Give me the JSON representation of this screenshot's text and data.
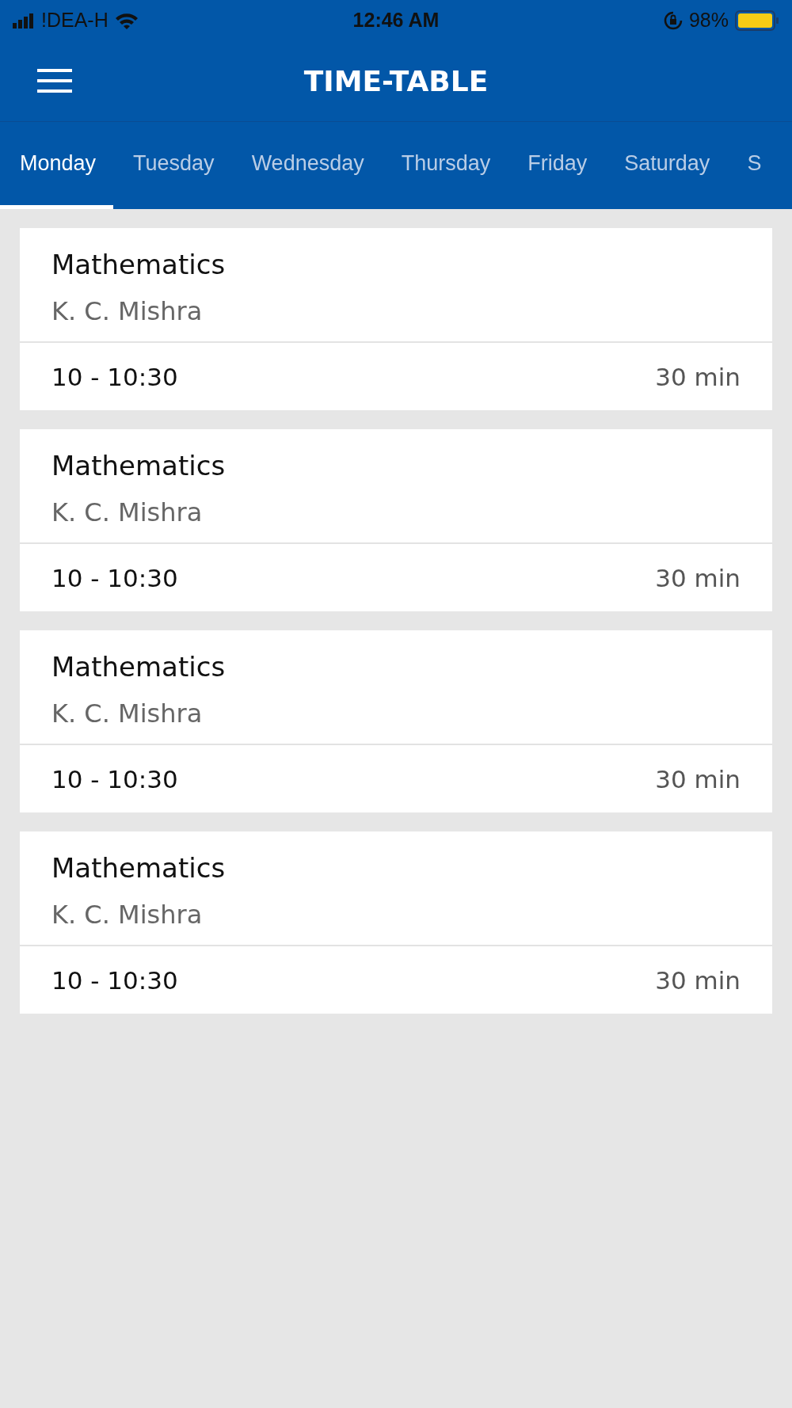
{
  "status_bar": {
    "carrier": "!DEA-H",
    "time": "12:46 AM",
    "battery": "98%"
  },
  "header": {
    "title": "TIME-TABLE"
  },
  "tabs": [
    {
      "label": "Monday",
      "selected": true
    },
    {
      "label": "Tuesday",
      "selected": false
    },
    {
      "label": "Wednesday",
      "selected": false
    },
    {
      "label": "Thursday",
      "selected": false
    },
    {
      "label": "Friday",
      "selected": false
    },
    {
      "label": "Saturday",
      "selected": false
    },
    {
      "label": "S",
      "selected": false
    }
  ],
  "classes": [
    {
      "subject": "Mathematics",
      "teacher": "K. C. Mishra",
      "time": "10 - 10:30",
      "duration": "30 min"
    },
    {
      "subject": "Mathematics",
      "teacher": "K. C. Mishra",
      "time": "10 - 10:30",
      "duration": "30 min"
    },
    {
      "subject": "Mathematics",
      "teacher": "K. C. Mishra",
      "time": "10 - 10:30",
      "duration": "30 min"
    },
    {
      "subject": "Mathematics",
      "teacher": "K. C. Mishra",
      "time": "10 - 10:30",
      "duration": "30 min"
    }
  ]
}
